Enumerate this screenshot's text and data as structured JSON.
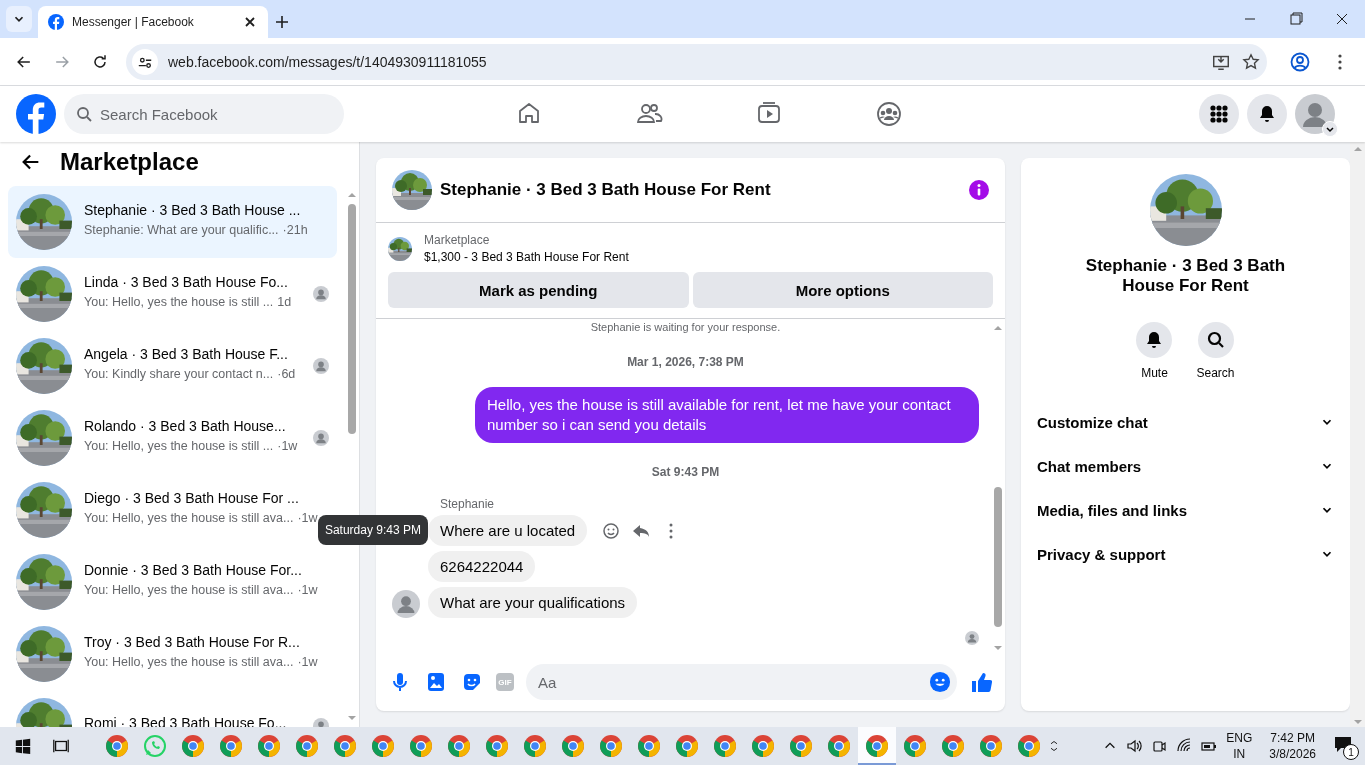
{
  "browser": {
    "tab": {
      "title": "Messenger | Facebook"
    },
    "url": "web.facebook.com/messages/t/1404930911181055"
  },
  "header": {
    "search": {
      "placeholder": "Search Facebook"
    },
    "nav": [
      {
        "kind": "home"
      },
      {
        "kind": "friends"
      },
      {
        "kind": "watch"
      },
      {
        "kind": "groups"
      }
    ]
  },
  "sidebar": {
    "title": "Marketplace",
    "conversations": [
      {
        "name": "Stephanie · 3 Bed 3 Bath House ...",
        "preview": "Stephanie: What are your qualific...",
        "time": "·21h",
        "seen": false,
        "selected": true
      },
      {
        "name": "Linda · 3 Bed 3 Bath House Fo...",
        "preview": "You: Hello, yes the house is still ...",
        "time": "1d",
        "seen": true,
        "selected": false
      },
      {
        "name": "Angela · 3 Bed 3 Bath House F...",
        "preview": "You: Kindly share your contact n...",
        "time": "·6d",
        "seen": true,
        "selected": false
      },
      {
        "name": "Rolando · 3 Bed 3 Bath House...",
        "preview": "You: Hello, yes the house is still ...",
        "time": "·1w",
        "seen": true,
        "selected": false
      },
      {
        "name": "Diego · 3 Bed 3 Bath House For ...",
        "preview": "You: Hello, yes the house is still ava...",
        "time": "·1w",
        "seen": false,
        "selected": false
      },
      {
        "name": "Donnie · 3 Bed 3 Bath House For...",
        "preview": "You: Hello, yes the house is still ava...",
        "time": "·1w",
        "seen": false,
        "selected": false
      },
      {
        "name": "Troy · 3 Bed 3 Bath House For R...",
        "preview": "You: Hello, yes the house is still ava...",
        "time": "·1w",
        "seen": false,
        "selected": false
      },
      {
        "name": "Romi · 3 Bed 3 Bath House Fo...",
        "seen": true,
        "selected": false
      }
    ]
  },
  "chat": {
    "title": "Stephanie · 3 Bed 3 Bath House For Rent",
    "listing": {
      "source": "Marketplace",
      "summary": "$1,300 - 3 Bed 3 Bath House For Rent"
    },
    "buttons": [
      "Mark as pending",
      "More options"
    ],
    "messages": [
      {
        "kind": "notice",
        "text": "Stephanie is waiting for your response."
      },
      {
        "kind": "timestamp",
        "text": "Mar 1, 2026, 7:38 PM"
      },
      {
        "kind": "outgoing",
        "text": "Hello, yes the house is still available for rent, let me have your contact number so i can send you  details"
      },
      {
        "kind": "timestamp",
        "text": "Sat 9:43 PM"
      },
      {
        "kind": "sender",
        "text": "Stephanie"
      },
      {
        "kind": "incoming",
        "text": "Where are u located",
        "hovered": true,
        "tooltip": "Saturday 9:43 PM",
        "avatar": false
      },
      {
        "kind": "incoming",
        "text": "6264222044",
        "hovered": false,
        "avatar": false
      },
      {
        "kind": "incoming",
        "text": "What are your qualifications",
        "hovered": false,
        "avatar": true
      }
    ],
    "composer": {
      "placeholder": "Aa",
      "gif": "GIF"
    }
  },
  "details": {
    "name": "Stephanie · 3 Bed 3 Bath House For Rent",
    "actions": [
      {
        "kind": "mute",
        "label": "Mute"
      },
      {
        "kind": "search",
        "label": "Search"
      }
    ],
    "sections": [
      {
        "label": "Customize chat",
        "expanded": false
      },
      {
        "label": "Chat members",
        "expanded": false
      },
      {
        "label": "Media, files and links",
        "expanded": false
      },
      {
        "label": "Privacy & support",
        "expanded": false
      }
    ]
  },
  "taskbar": {
    "apps": [
      {
        "kind": "chrome",
        "selected": false
      },
      {
        "kind": "whatsapp",
        "selected": false
      },
      {
        "kind": "chrome",
        "selected": false
      },
      {
        "kind": "chrome",
        "selected": false
      },
      {
        "kind": "chrome",
        "selected": false
      },
      {
        "kind": "chrome",
        "selected": false
      },
      {
        "kind": "chrome",
        "selected": false
      },
      {
        "kind": "chrome",
        "selected": false
      },
      {
        "kind": "chrome",
        "selected": false
      },
      {
        "kind": "chrome",
        "selected": false
      },
      {
        "kind": "chrome",
        "selected": false
      },
      {
        "kind": "chrome",
        "selected": false
      },
      {
        "kind": "chrome",
        "selected": false
      },
      {
        "kind": "chrome",
        "selected": false
      },
      {
        "kind": "chrome",
        "selected": false
      },
      {
        "kind": "chrome",
        "selected": false
      },
      {
        "kind": "chrome",
        "selected": false
      },
      {
        "kind": "chrome",
        "selected": false
      },
      {
        "kind": "chrome",
        "selected": false
      },
      {
        "kind": "chrome",
        "selected": false
      },
      {
        "kind": "chrome",
        "selected": true
      },
      {
        "kind": "chrome",
        "selected": false
      },
      {
        "kind": "chrome",
        "selected": false
      },
      {
        "kind": "chrome",
        "selected": false
      },
      {
        "kind": "chrome",
        "selected": false
      }
    ],
    "language": "ENG",
    "region": "IN",
    "time": "7:42 PM",
    "date": "3/8/2026",
    "notifications": "1"
  }
}
